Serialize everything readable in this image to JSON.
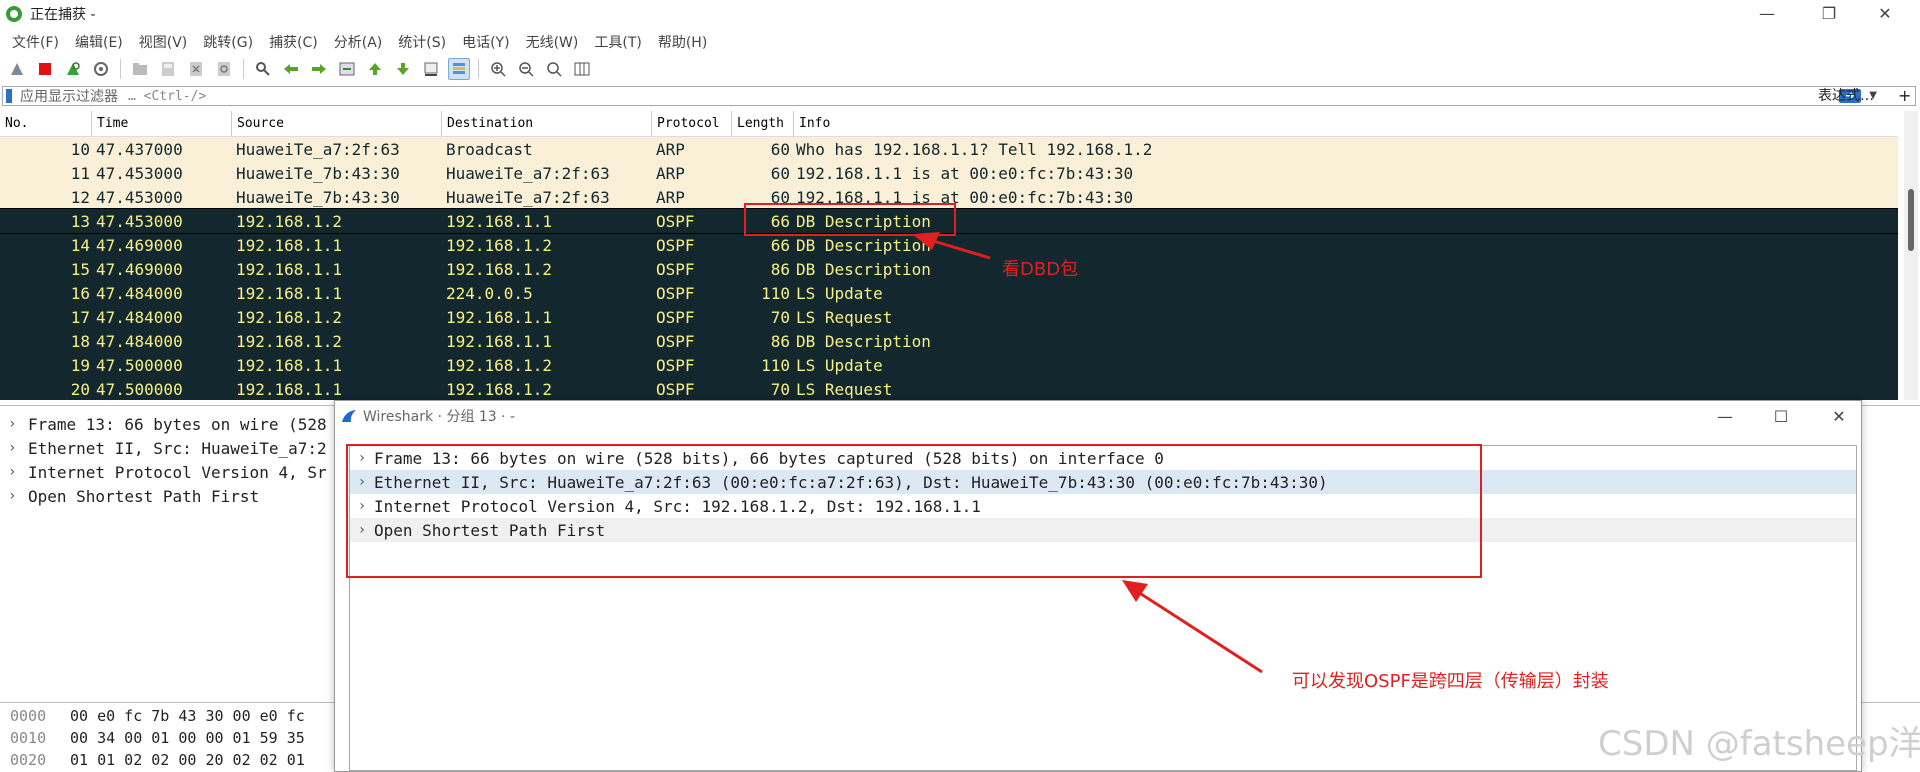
{
  "window": {
    "title": "正在捕获 -"
  },
  "menu": [
    "文件(F)",
    "编辑(E)",
    "视图(V)",
    "跳转(G)",
    "捕获(C)",
    "分析(A)",
    "统计(S)",
    "电话(Y)",
    "无线(W)",
    "工具(T)",
    "帮助(H)"
  ],
  "filter": {
    "placeholder": "应用显示过滤器 … <Ctrl-/>",
    "label": "应用显示过滤器",
    "shortcut": "… <Ctrl-/>",
    "expression_label": "表达式…",
    "add_label": "+"
  },
  "columns": [
    "No.",
    "Time",
    "Source",
    "Destination",
    "Protocol",
    "Length",
    "Info"
  ],
  "packets": [
    {
      "no": "10",
      "time": "47.437000",
      "src": "HuaweiTe_a7:2f:63",
      "dst": "Broadcast",
      "proto": "ARP",
      "len": "60",
      "info": "Who has 192.168.1.1? Tell 192.168.1.2"
    },
    {
      "no": "11",
      "time": "47.453000",
      "src": "HuaweiTe_7b:43:30",
      "dst": "HuaweiTe_a7:2f:63",
      "proto": "ARP",
      "len": "60",
      "info": "192.168.1.1 is at 00:e0:fc:7b:43:30"
    },
    {
      "no": "12",
      "time": "47.453000",
      "src": "HuaweiTe_7b:43:30",
      "dst": "HuaweiTe_a7:2f:63",
      "proto": "ARP",
      "len": "60",
      "info": "192.168.1.1 is at 00:e0:fc:7b:43:30"
    },
    {
      "no": "13",
      "time": "47.453000",
      "src": "192.168.1.2",
      "dst": "192.168.1.1",
      "proto": "OSPF",
      "len": "66",
      "info": "DB Description"
    },
    {
      "no": "14",
      "time": "47.469000",
      "src": "192.168.1.1",
      "dst": "192.168.1.2",
      "proto": "OSPF",
      "len": "66",
      "info": "DB Description"
    },
    {
      "no": "15",
      "time": "47.469000",
      "src": "192.168.1.1",
      "dst": "192.168.1.2",
      "proto": "OSPF",
      "len": "86",
      "info": "DB Description"
    },
    {
      "no": "16",
      "time": "47.484000",
      "src": "192.168.1.1",
      "dst": "224.0.0.5",
      "proto": "OSPF",
      "len": "110",
      "info": "LS Update"
    },
    {
      "no": "17",
      "time": "47.484000",
      "src": "192.168.1.2",
      "dst": "192.168.1.1",
      "proto": "OSPF",
      "len": "70",
      "info": "LS Request"
    },
    {
      "no": "18",
      "time": "47.484000",
      "src": "192.168.1.2",
      "dst": "192.168.1.1",
      "proto": "OSPF",
      "len": "86",
      "info": "DB Description"
    },
    {
      "no": "19",
      "time": "47.500000",
      "src": "192.168.1.1",
      "dst": "192.168.1.2",
      "proto": "OSPF",
      "len": "110",
      "info": "LS Update"
    },
    {
      "no": "20",
      "time": "47.500000",
      "src": "192.168.1.1",
      "dst": "192.168.1.2",
      "proto": "OSPF",
      "len": "70",
      "info": "LS Request"
    }
  ],
  "details_background": [
    "Frame 13: 66 bytes on wire (528",
    "Ethernet II, Src: HuaweiTe_a7:2",
    "Internet Protocol Version 4, Sr",
    "Open Shortest Path First"
  ],
  "bytes_background": [
    {
      "offset": "0000",
      "hex": "00 e0 fc 7b 43 30 00 e0  fc"
    },
    {
      "offset": "0010",
      "hex": "00 34 00 01 00 00 01 59  35"
    },
    {
      "offset": "0020",
      "hex": "01 01 02 02 00 20 02 02  01"
    }
  ],
  "dialog": {
    "title": "Wireshark · 分组 13 · -",
    "tree": [
      "Frame 13: 66 bytes on wire (528 bits), 66 bytes captured (528 bits) on interface 0",
      "Ethernet II, Src: HuaweiTe_a7:2f:63 (00:e0:fc:a7:2f:63), Dst: HuaweiTe_7b:43:30 (00:e0:fc:7b:43:30)",
      "Internet Protocol Version 4, Src: 192.168.1.2, Dst: 192.168.1.1",
      "Open Shortest Path First"
    ]
  },
  "annotations": {
    "dbd": "看DBD包",
    "ospf_note": "可以发现OSPF是跨四层（传输层）封装"
  },
  "watermark": "CSDN @fatsheep洋",
  "colors": {
    "arp_row": "#faf0d7",
    "ospf_row": "#12272e",
    "ospf_text": "#f7f089",
    "annotation": "#e02020",
    "selected_tree_row": "#dce9f4"
  }
}
